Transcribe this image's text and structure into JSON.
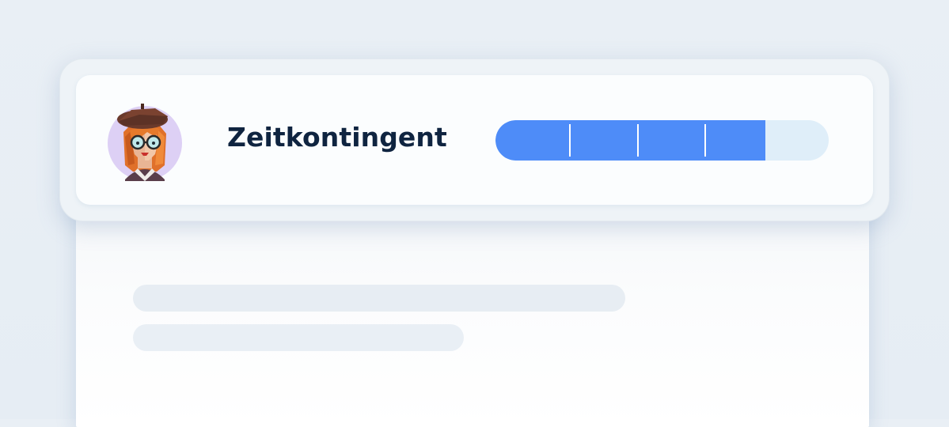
{
  "time_quota": {
    "label": "Zeitkontingent",
    "progress_fraction": 0.81,
    "segment_count": 4,
    "fill_color": "#4e8cf8",
    "track_color": "#dfeef9"
  },
  "avatar": {
    "icon": "user-avatar-beret-glasses-icon",
    "background_color": "#ddd0f5"
  },
  "skeleton_lines": [
    "placeholder-line",
    "placeholder-line"
  ]
}
